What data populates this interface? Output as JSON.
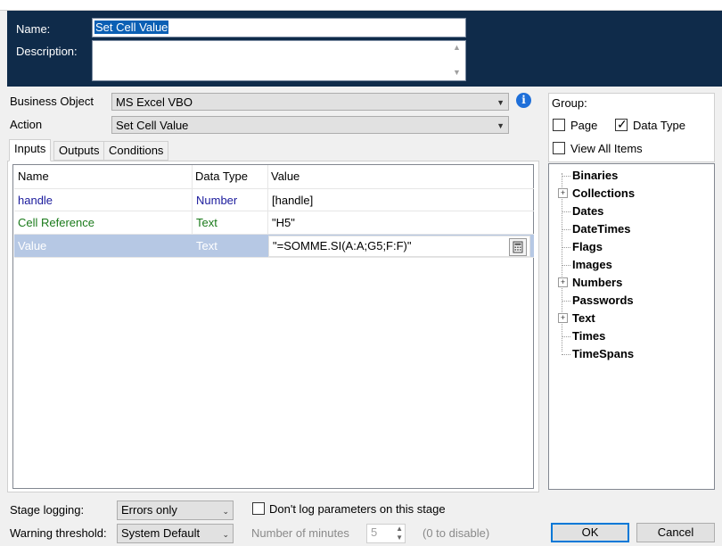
{
  "header": {
    "name_label": "Name:",
    "name_value": "Set Cell Value",
    "description_label": "Description:",
    "description_value": ""
  },
  "business_object": {
    "label": "Business Object",
    "value": "MS Excel VBO"
  },
  "action": {
    "label": "Action",
    "value": "Set Cell Value"
  },
  "tabs": [
    {
      "label": "Inputs",
      "active": true
    },
    {
      "label": "Outputs",
      "active": false
    },
    {
      "label": "Conditions",
      "active": false
    }
  ],
  "grid": {
    "columns": [
      "Name",
      "Data Type",
      "Value"
    ],
    "rows": [
      {
        "name": "handle",
        "type": "Number",
        "value": "[handle]",
        "color": "#1a1a9c"
      },
      {
        "name": "Cell Reference",
        "type": "Text",
        "value": "\"H5\"",
        "color": "#1a7a1a"
      },
      {
        "name": "Value",
        "type": "Text",
        "value": "\"=SOMME.SI(A:A;G5;F:F)\"",
        "selected": true
      }
    ]
  },
  "group": {
    "label": "Group:",
    "page_label": "Page",
    "page_checked": false,
    "datatype_label": "Data Type",
    "datatype_checked": true,
    "view_all_label": "View All Items",
    "view_all_checked": false
  },
  "tree_items": [
    {
      "label": "Binaries",
      "expandable": false
    },
    {
      "label": "Collections",
      "expandable": true
    },
    {
      "label": "Dates",
      "expandable": false
    },
    {
      "label": "DateTimes",
      "expandable": false
    },
    {
      "label": "Flags",
      "expandable": false
    },
    {
      "label": "Images",
      "expandable": false
    },
    {
      "label": "Numbers",
      "expandable": true
    },
    {
      "label": "Passwords",
      "expandable": false
    },
    {
      "label": "Text",
      "expandable": true
    },
    {
      "label": "Times",
      "expandable": false
    },
    {
      "label": "TimeSpans",
      "expandable": false
    }
  ],
  "footer": {
    "stage_logging_label": "Stage logging:",
    "stage_logging_value": "Errors only",
    "dont_log_label": "Don't log parameters on this stage",
    "warning_label": "Warning threshold:",
    "warning_value": "System Default",
    "minutes_label": "Number of minutes",
    "minutes_value": "5",
    "disable_hint": "(0 to disable)",
    "ok_label": "OK",
    "cancel_label": "Cancel"
  },
  "colors": {
    "header_bg": "#0f2b4a",
    "selection": "#b6c8e4",
    "info_icon": "#1e6fd9"
  }
}
